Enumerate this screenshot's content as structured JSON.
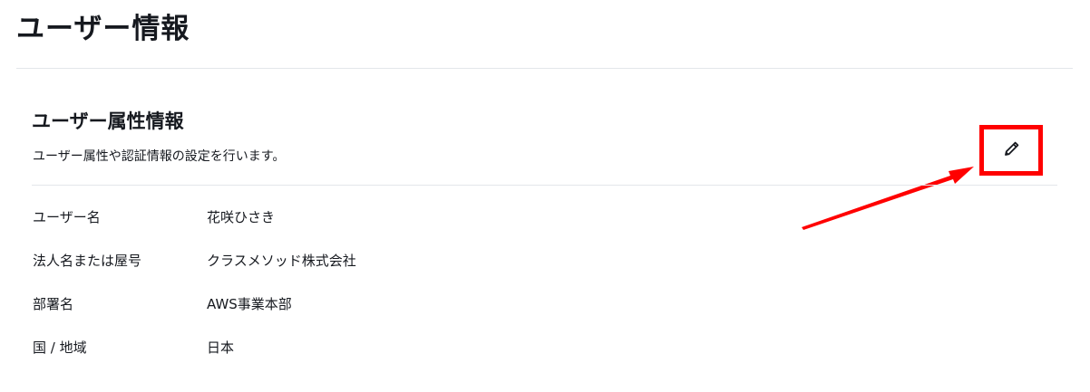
{
  "page": {
    "title": "ユーザー情報"
  },
  "section": {
    "title": "ユーザー属性情報",
    "description": "ユーザー属性や認証情報の設定を行います。",
    "edit_icon": "pencil-icon"
  },
  "attributes": [
    {
      "label": "ユーザー名",
      "value": "花咲ひさき"
    },
    {
      "label": "法人名または屋号",
      "value": "クラスメソッド株式会社"
    },
    {
      "label": "部署名",
      "value": "AWS事業本部"
    },
    {
      "label": "国 / 地域",
      "value": "日本"
    }
  ],
  "colors": {
    "annotation": "#ff0000",
    "divider": "#e3e6ea",
    "text": "#16191f"
  }
}
